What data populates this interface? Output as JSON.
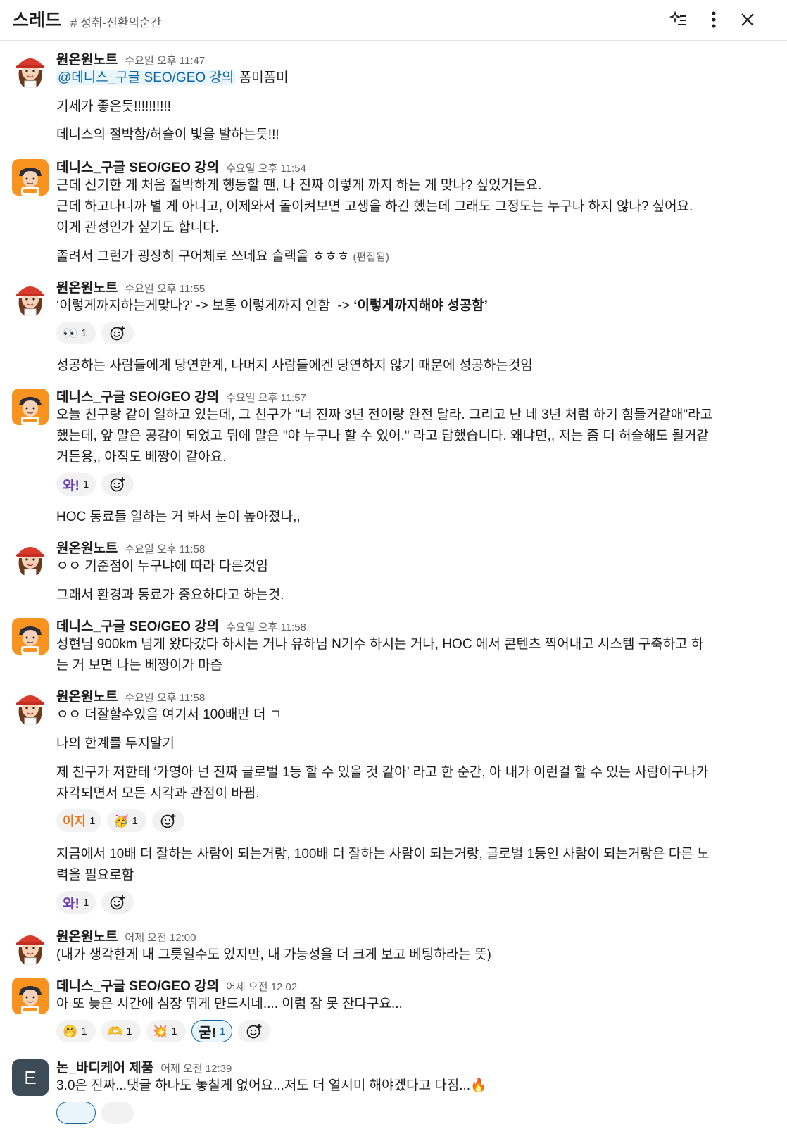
{
  "header": {
    "title": "스레드",
    "channel": "# 성취-전환의순간"
  },
  "messages": [
    {
      "author": "원온원노트",
      "time": "수요일 오후 11:47",
      "mention": "@데니스_구글 SEO/GEO 강의",
      "line1_rest": " 폼미폼미",
      "line2": "기세가 좋은듯!!!!!!!!!!",
      "line3": "데니스의 절박함/허슬이 빛을 발하는듯!!!"
    },
    {
      "author": "데니스_구글 SEO/GEO 강의",
      "time": "수요일 오후 11:54",
      "line1": "근데 신기한 게 처음 절박하게 행동할 땐, 나 진짜 이렇게 까지 하는 게 맞나? 싶었거든요.",
      "line2": "근데 하고나니까 별 게 아니고, 이제와서 돌이켜보면 고생을 하긴 했는데 그래도 그정도는 누구나 하지 않나? 싶어요.",
      "line3": "이게 관성인가 싶기도 합니다.",
      "line4": "졸려서 그런가 굉장히 구어체로 쓰네요 슬랙을 ㅎㅎㅎ ",
      "edited": "(편집됨)"
    },
    {
      "author": "원온원노트",
      "time": "수요일 오후 11:55",
      "line1_a": "‘이렇게까지하는게맞나?’ -> 보통 이렇게까지 안함  -> ",
      "line1_b": "‘이렇게까지해야 성공함’",
      "reaction1_count": "1",
      "line2": "성공하는 사람들에게 당연한게, 나머지 사람들에겐 당연하지 않기 때문에 성공하는것임"
    },
    {
      "author": "데니스_구글 SEO/GEO 강의",
      "time": "수요일 오후 11:57",
      "line1": "오늘 친구랑 같이 일하고 있는데, 그 친구가 \"너 진짜 3년 전이랑 완전 달라. 그리고 난 네 3년 처럼 하기 힘들거같애\"라고",
      "line2": "했는데, 앞 말은 공감이 되었고 뒤에 말은 \"야 누구나 할 수 있어.\" 라고 답했습니다. 왜냐면,, 저는 좀 더 허슬해도 될거같",
      "line3": "거든용,, 아직도 베짱이 같아요.",
      "reaction_label": "와!",
      "reaction_count": "1",
      "line4": "HOC 동료들 일하는 거 봐서 눈이 높아졌나,,"
    },
    {
      "author": "원온원노트",
      "time": "수요일 오후 11:58",
      "line1": "ㅇㅇ 기준점이 누구냐에 따라 다른것임",
      "line2": "그래서 환경과 동료가 중요하다고 하는것."
    },
    {
      "author": "데니스_구글 SEO/GEO 강의",
      "time": "수요일 오후 11:58",
      "line1": "성현님 900km 넘게 왔다갔다 하시는 거나 유하님 N기수 하시는 거나, HOC 에서 콘텐츠 찍어내고 시스템 구축하고 하",
      "line2": "는 거 보면 나는 베짱이가 마즘"
    },
    {
      "author": "원온원노트",
      "time": "수요일 오후 11:58",
      "line1": "ㅇㅇ 더잘할수있음 여기서 100배만 더 ㄱ",
      "line2": "나의 한계를 두지말기",
      "line3": "제 친구가 저한테 ‘가영아 넌 진짜 글로벌 1등 할 수 있을 것 같아’ 라고 한 순간, 아 내가 이런걸 할 수 있는 사람이구나가",
      "line4": "자각되면서 모든 시각과 관점이 바뀜.",
      "reaction1_label": "이지",
      "reaction1_count": "1",
      "reaction2_count": "1",
      "line5": "지금에서 10배 더 잘하는 사람이 되는거랑, 100배 더 잘하는 사람이 되는거랑, 글로벌 1등인 사람이 되는거랑은 다른 노",
      "line6": "력을 필요로함",
      "reaction3_label": "와!",
      "reaction3_count": "1"
    },
    {
      "author": "원온원노트",
      "time": "어제 오전 12:00",
      "line1": "(내가 생각한게 내 그릇일수도 있지만, 내 가능성을 더 크게 보고 베팅하라는 뜻)"
    },
    {
      "author": "데니스_구글 SEO/GEO 강의",
      "time": "어제 오전 12:02",
      "line1": "아 또 늦은 시간에 심장 뛰게 만드시네.... 이럼 잠 못 잔다구요...",
      "reactions": [
        {
          "emoji": "🤭",
          "count": "1"
        },
        {
          "emoji": "🫶",
          "count": "1"
        },
        {
          "emoji": "💥",
          "count": "1"
        },
        {
          "label": "굳!",
          "count": "1"
        }
      ]
    },
    {
      "author": "논_바디케어 제품",
      "avatar_letter": "E",
      "time": "어제 오전 12:39",
      "line1": "3.0은 진짜...댓글 하나도 놓칠게 없어요...저도 더 열시미 해야겠다고 다짐...",
      "line1_emoji": "🔥"
    }
  ],
  "icons": {
    "ai": "sparkle-list-icon",
    "more": "vertical-dots-icon",
    "close": "close-icon",
    "add_reaction": "add-reaction-icon"
  },
  "colors": {
    "mention_bg": "#e8f5fa",
    "mention_text": "#1264a3",
    "avatar_orange": "#f7931e",
    "avatar_gray": "#3c4b55"
  }
}
